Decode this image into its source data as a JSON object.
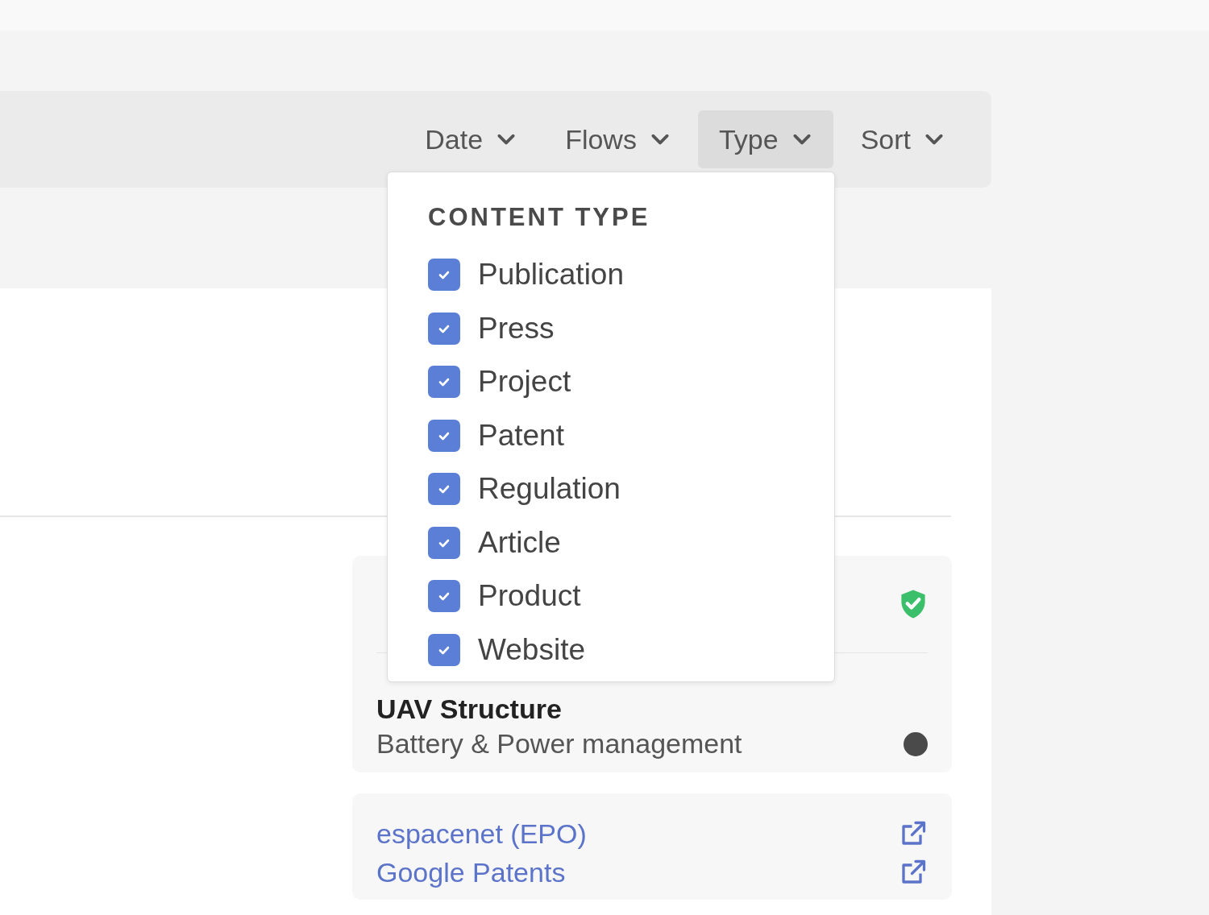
{
  "filters": [
    {
      "label": "Date",
      "selected": false
    },
    {
      "label": "Flows",
      "selected": false
    },
    {
      "label": "Type",
      "selected": true
    },
    {
      "label": "Sort",
      "selected": false
    }
  ],
  "type_menu": {
    "open": true,
    "heading": "CONTENT TYPE",
    "options": [
      {
        "label": "Publication",
        "checked": true
      },
      {
        "label": "Press",
        "checked": true
      },
      {
        "label": "Project",
        "checked": true
      },
      {
        "label": "Patent",
        "checked": true
      },
      {
        "label": "Regulation",
        "checked": true
      },
      {
        "label": "Article",
        "checked": true
      },
      {
        "label": "Product",
        "checked": true
      },
      {
        "label": "Website",
        "checked": true
      }
    ]
  },
  "topic_card": {
    "verified": true,
    "category": "UAV Structure",
    "subcategory": "Battery & Power management",
    "status_dot": true
  },
  "links": [
    {
      "label": "espacenet (EPO)"
    },
    {
      "label": "Google Patents"
    }
  ]
}
